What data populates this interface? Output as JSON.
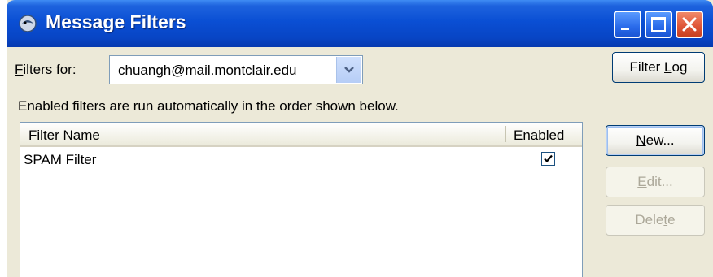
{
  "window": {
    "title": "Message Filters"
  },
  "filters_for": {
    "label_prefix": "",
    "label_accel": "F",
    "label_rest": "ilters for:",
    "selected": "chuangh@mail.montclair.edu"
  },
  "buttons": {
    "filter_log": {
      "pre": "Filter ",
      "accel": "L",
      "post": "og"
    },
    "new": {
      "pre": "",
      "accel": "N",
      "post": "ew..."
    },
    "edit": {
      "pre": "",
      "accel": "E",
      "post": "dit..."
    },
    "delete": {
      "pre": "Dele",
      "accel": "t",
      "post": "e"
    }
  },
  "description": "Enabled filters are run automatically in the order shown below.",
  "table": {
    "columns": [
      "Filter Name",
      "Enabled"
    ],
    "rows": [
      {
        "name": "SPAM Filter",
        "enabled": true
      }
    ]
  },
  "colors": {
    "titlebar": "#0a4fd4",
    "dialog": "#ece9d8",
    "border": "#7f9db9"
  }
}
